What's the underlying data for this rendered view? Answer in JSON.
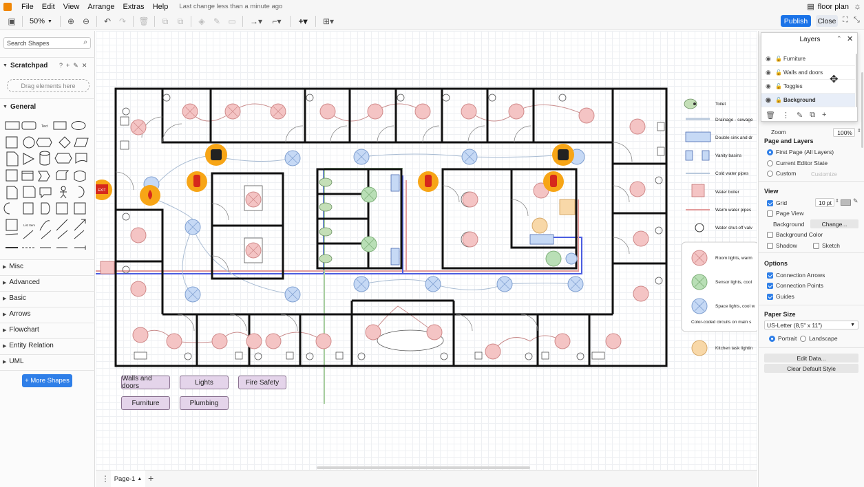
{
  "menubar": {
    "items": [
      "File",
      "Edit",
      "View",
      "Arrange",
      "Extras",
      "Help"
    ],
    "last_change": "Last change less than a minute ago",
    "doc_title": "floor plan"
  },
  "toolbar": {
    "zoom": "50%",
    "publish_label": "Publish",
    "close_label": "Close"
  },
  "sidebar": {
    "search_placeholder": "Search Shapes",
    "scratchpad_label": "Scratchpad",
    "drag_hint": "Drag elements here",
    "general_label": "General",
    "sections": [
      "Misc",
      "Advanced",
      "Basic",
      "Arrows",
      "Flowchart",
      "Entity Relation",
      "UML"
    ],
    "more_shapes_label": "+ More Shapes"
  },
  "canvas": {
    "layer_buttons": [
      "Walls and doors",
      "Lights",
      "Fire Safety",
      "Furniture",
      "Plumbing"
    ],
    "legend": [
      {
        "label": "Toilet"
      },
      {
        "label": "Drainage - sewage"
      },
      {
        "label": "Double sink and dr"
      },
      {
        "label": "Vanity basins"
      },
      {
        "label": "Cold water pipes"
      },
      {
        "label": "Water boiler"
      },
      {
        "label": "Warm water pipes"
      },
      {
        "label": "Water shut-off valv"
      }
    ],
    "circuits": [
      {
        "label": "Room lights, warm"
      },
      {
        "label": "Sensor lights, cool"
      },
      {
        "label": "Space lights, cool w"
      },
      {
        "label": "Color-coded circuits on main s"
      }
    ],
    "kitchen_label": "Kitchen task lightin",
    "exit_sign": "EXIT"
  },
  "pages": {
    "tab_label": "Page-1"
  },
  "layers_dialog": {
    "title": "Layers",
    "layers": [
      "Furniture",
      "Walls and doors",
      "Toggles",
      "Background"
    ]
  },
  "format_panel": {
    "zoom_label": "Zoom",
    "zoom_value": "100%",
    "page_and_layers": "Page and Layers",
    "radio_options": [
      "First Page (All Layers)",
      "Current Editor State",
      "Custom"
    ],
    "customize_label": "Customize",
    "view_heading": "View",
    "grid_label": "Grid",
    "grid_size": "10 pt",
    "page_view_label": "Page View",
    "background_label": "Background",
    "change_label": "Change...",
    "background_color_label": "Background Color",
    "shadow_label": "Shadow",
    "sketch_label": "Sketch",
    "options_heading": "Options",
    "options": [
      "Connection Arrows",
      "Connection Points",
      "Guides"
    ],
    "paper_size_heading": "Paper Size",
    "paper_size_value": "US-Letter (8,5\" x 11\")",
    "portrait_label": "Portrait",
    "landscape_label": "Landscape",
    "edit_data_label": "Edit Data...",
    "clear_style_label": "Clear Default Style"
  },
  "colors": {
    "accent": "#1a73e8",
    "room_light": "#f4c4c4",
    "sensor_light": "#b9dfb6",
    "space_light": "#c6d9f5",
    "kitchen_light": "#f8d8a8",
    "fire_safety": "#f7a516",
    "layer_button_fill": "#e4d4ea"
  }
}
